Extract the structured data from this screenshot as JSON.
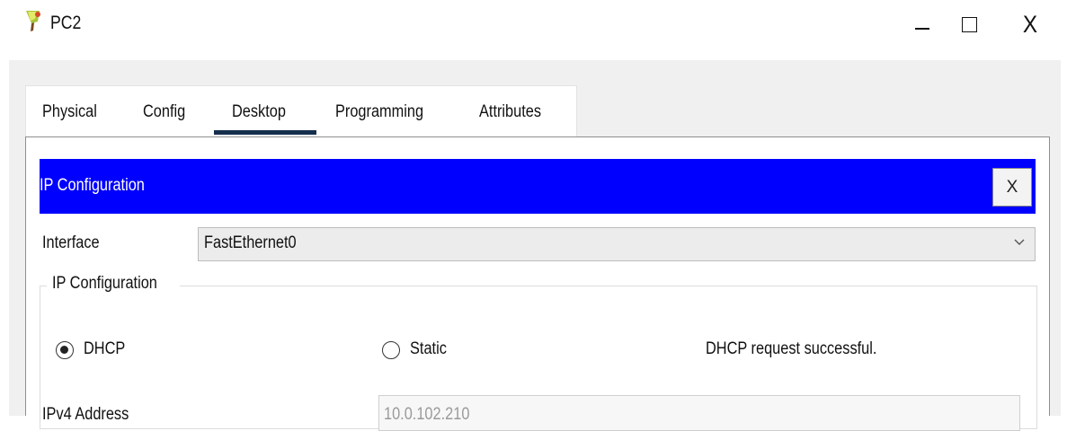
{
  "window": {
    "title": "PC2",
    "icon": "packet-tracer-pc-icon",
    "controls": {
      "minimize": "minimize-icon",
      "maximize": "maximize-icon",
      "close": "X"
    }
  },
  "tabs": [
    {
      "label": "Physical",
      "active": false
    },
    {
      "label": "Config",
      "active": false
    },
    {
      "label": "Desktop",
      "active": true
    },
    {
      "label": "Programming",
      "active": false
    },
    {
      "label": "Attributes",
      "active": false
    }
  ],
  "ip_config": {
    "header_title": "IP Configuration",
    "close_label": "X",
    "interface_label": "Interface",
    "interface_value": "FastEthernet0",
    "group_title": "IP Configuration",
    "mode_options": [
      {
        "label": "DHCP",
        "selected": true
      },
      {
        "label": "Static",
        "selected": false
      }
    ],
    "status": "DHCP request successful.",
    "ipv4_label": "IPv4 Address",
    "ipv4_value": "10.0.102.210"
  },
  "colors": {
    "header_bg": "#0000ff",
    "active_tab_underline": "#152e4c",
    "window_bg": "#f0f0f0"
  }
}
